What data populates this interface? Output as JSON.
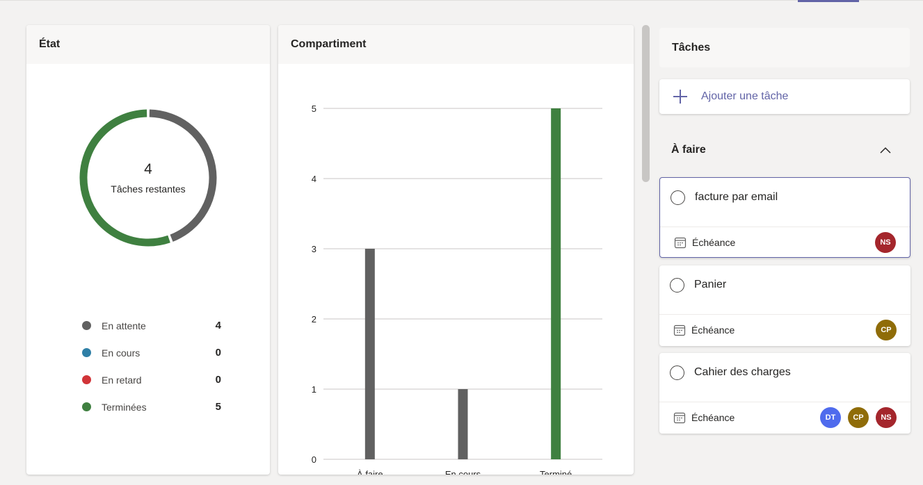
{
  "etat": {
    "title": "État",
    "remaining_count": "4",
    "remaining_label": "Tâches restantes",
    "donut": {
      "termine": 5,
      "en_attente": 4,
      "termine_color": "#3f8040",
      "en_attente_color": "#616161"
    },
    "legend": [
      {
        "label": "En attente",
        "value": "4",
        "color": "#616161"
      },
      {
        "label": "En cours",
        "value": "0",
        "color": "#2f7fa6"
      },
      {
        "label": "En retard",
        "value": "0",
        "color": "#d13438"
      },
      {
        "label": "Terminées",
        "value": "5",
        "color": "#3f8040"
      }
    ]
  },
  "compartiment": {
    "title": "Compartiment"
  },
  "chart_data": {
    "type": "bar",
    "categories": [
      "À faire",
      "En cours",
      "Terminé"
    ],
    "values": [
      3,
      1,
      5
    ],
    "colors": [
      "#616161",
      "#616161",
      "#3f8040"
    ],
    "ylim": [
      0,
      5
    ],
    "yticks": [
      "0",
      "1",
      "2",
      "3",
      "4",
      "5"
    ],
    "grid": true
  },
  "taches": {
    "title": "Tâches",
    "add_label": "Ajouter une tâche",
    "section_title": "À faire",
    "tasks": [
      {
        "title": "facture par email",
        "due": "Échéance",
        "avatars": [
          {
            "initials": "NS",
            "color": "#a4262c"
          }
        ]
      },
      {
        "title": "Panier",
        "due": "Échéance",
        "avatars": [
          {
            "initials": "CP",
            "color": "#8f6c08"
          }
        ]
      },
      {
        "title": "Cahier des charges",
        "due": "Échéance",
        "avatars": [
          {
            "initials": "DT",
            "color": "#4f6bed"
          },
          {
            "initials": "CP",
            "color": "#8f6c08"
          },
          {
            "initials": "NS",
            "color": "#a4262c"
          }
        ]
      }
    ]
  }
}
